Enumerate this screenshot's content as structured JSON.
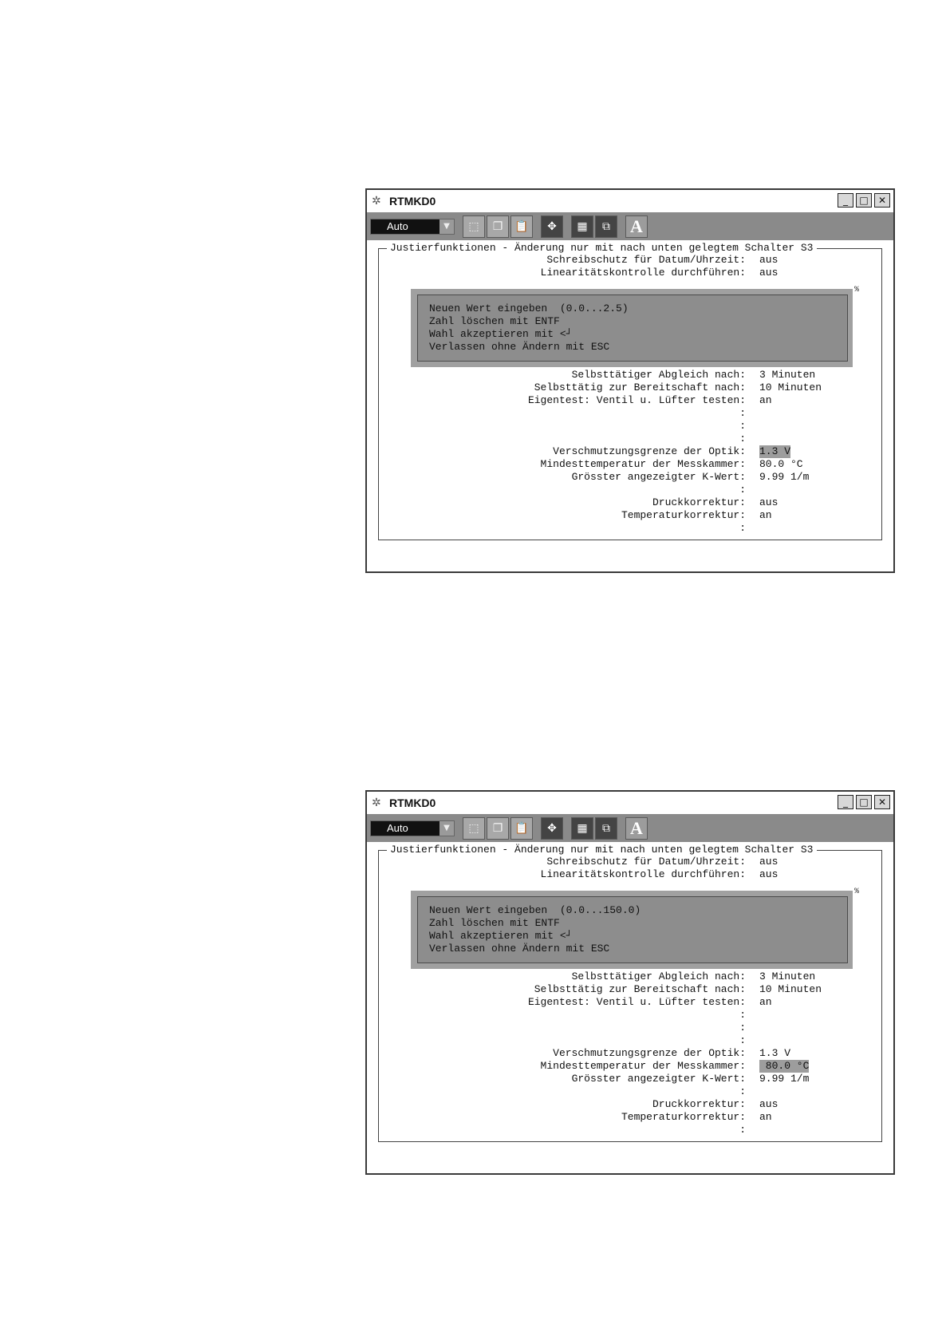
{
  "windows": [
    {
      "title": "RTMKD0",
      "toolbar": {
        "mode": "Auto"
      },
      "group_title": "Justierfunktionen - Änderung nur mit nach unten gelegtem Schalter S3",
      "rows_top": [
        {
          "label": "Schreibschutz für Datum/Uhrzeit:",
          "value": "aus"
        },
        {
          "label": "Linearitätskontrolle durchführen:",
          "value": "aus"
        }
      ],
      "popup": [
        "Neuen Wert eingeben  (0.0...2.5)",
        "Zahl löschen mit ENTF",
        "Wahl akzeptieren mit <┘",
        "Verlassen ohne Ändern mit ESC"
      ],
      "corner_mark": "%",
      "rows": [
        {
          "label": "Selbsttätiger Abgleich nach:",
          "value": "3 Minuten"
        },
        {
          "label": "Selbsttätig zur Bereitschaft nach:",
          "value": "10 Minuten"
        },
        {
          "label": "Eigentest: Ventil u. Lüfter testen:",
          "value": "an"
        },
        {
          "label": ":",
          "value": ""
        },
        {
          "label": ":",
          "value": ""
        },
        {
          "label": ":",
          "value": ""
        },
        {
          "label": "Verschmutzungsgrenze der Optik:",
          "value": "1.3 V"
        },
        {
          "label": "Mindesttemperatur der Messkammer:",
          "value": "80.0 °C"
        },
        {
          "label": "Grösster angezeigter K-Wert:",
          "value": "9.99 1/m"
        },
        {
          "label": ":",
          "value": ""
        },
        {
          "label": "Druckkorrektur:",
          "value": "aus"
        },
        {
          "label": "Temperaturkorrektur:",
          "value": "an"
        },
        {
          "label": ":",
          "value": ""
        }
      ]
    },
    {
      "title": "RTMKD0",
      "toolbar": {
        "mode": "Auto"
      },
      "group_title": "Justierfunktionen - Änderung nur mit nach unten gelegtem Schalter S3",
      "rows_top": [
        {
          "label": "Schreibschutz für Datum/Uhrzeit:",
          "value": "aus"
        },
        {
          "label": "Linearitätskontrolle durchführen:",
          "value": "aus"
        }
      ],
      "popup": [
        "Neuen Wert eingeben  (0.0...150.0)",
        "Zahl löschen mit ENTF",
        "Wahl akzeptieren mit <┘",
        "Verlassen ohne Ändern mit ESC"
      ],
      "corner_mark": "%",
      "rows": [
        {
          "label": "Selbsttätiger Abgleich nach:",
          "value": "3 Minuten"
        },
        {
          "label": "Selbsttätig zur Bereitschaft nach:",
          "value": "10 Minuten"
        },
        {
          "label": "Eigentest: Ventil u. Lüfter testen:",
          "value": "an"
        },
        {
          "label": ":",
          "value": ""
        },
        {
          "label": ":",
          "value": ""
        },
        {
          "label": ":",
          "value": ""
        },
        {
          "label": "Verschmutzungsgrenze der Optik:",
          "value": "1.3 V"
        },
        {
          "label": "Mindesttemperatur der Messkammer:",
          "value": " 80.0 °C"
        },
        {
          "label": "Grösster angezeigter K-Wert:",
          "value": "9.99 1/m"
        },
        {
          "label": ":",
          "value": ""
        },
        {
          "label": "Druckkorrektur:",
          "value": "aus"
        },
        {
          "label": "Temperaturkorrektur:",
          "value": "an"
        },
        {
          "label": ":",
          "value": ""
        }
      ]
    }
  ]
}
